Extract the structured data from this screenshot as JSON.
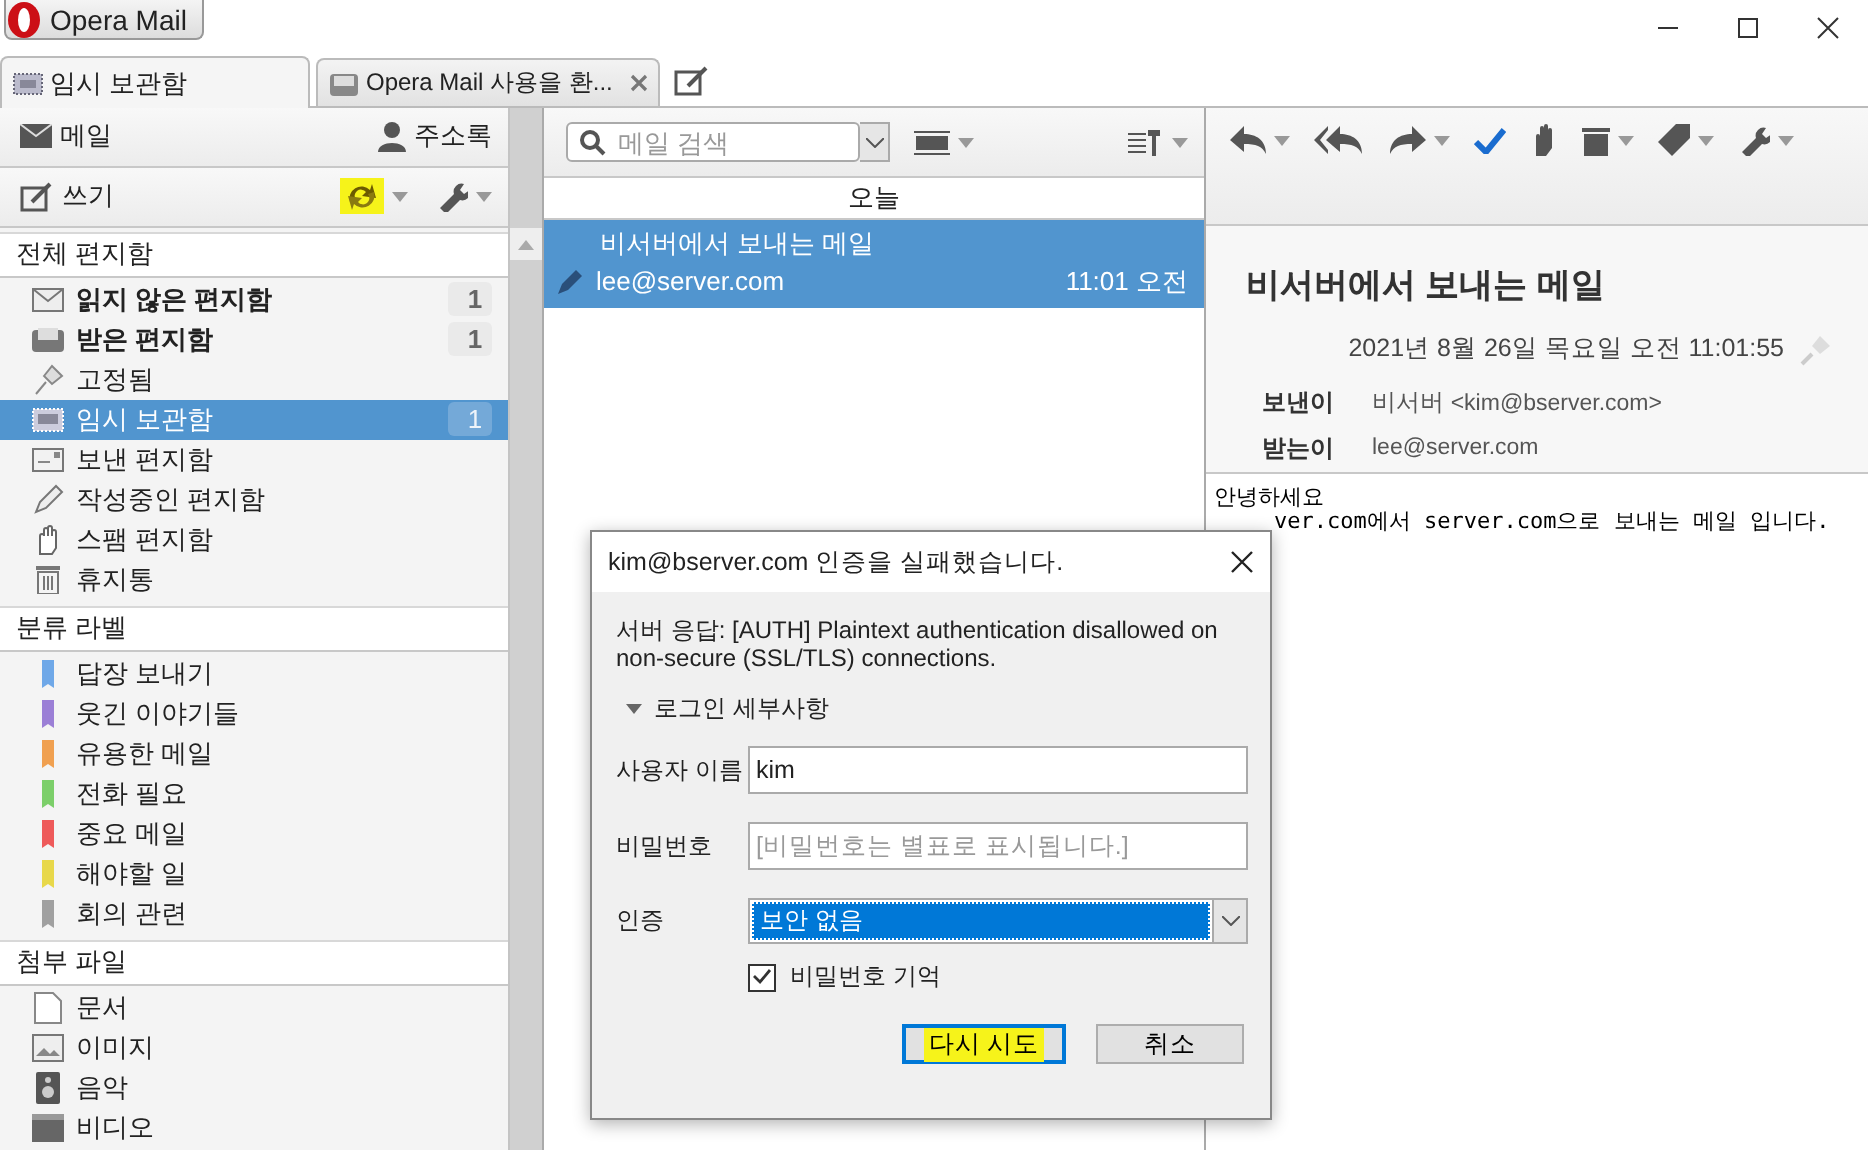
{
  "app_button": {
    "label": "Opera Mail"
  },
  "tabs": [
    {
      "label": "임시 보관함",
      "selected": true,
      "closable": false
    },
    {
      "label": "Opera Mail 사용을 환...",
      "selected": false,
      "closable": true
    }
  ],
  "sidebar": {
    "nav": [
      {
        "label": "메일"
      },
      {
        "label": "주소록"
      }
    ],
    "compose": {
      "label": "쓰기"
    },
    "sync_highlighted": true,
    "sections": [
      {
        "title": "전체 편지함",
        "items": [
          {
            "kind": "folder",
            "label": "읽지 않은 편지함",
            "unread": true,
            "selected": false,
            "count": "1"
          },
          {
            "kind": "folder",
            "label": "받은 편지함",
            "unread": true,
            "selected": false,
            "count": "1"
          },
          {
            "kind": "folder",
            "label": "고정됨",
            "unread": false,
            "selected": false
          },
          {
            "kind": "folder",
            "label": "임시 보관함",
            "unread": false,
            "selected": true,
            "count": "1"
          },
          {
            "kind": "folder",
            "label": "보낸 편지함",
            "unread": false,
            "selected": false
          },
          {
            "kind": "folder",
            "label": "작성중인 편지함",
            "unread": false,
            "selected": false
          },
          {
            "kind": "folder",
            "label": "스팸 편지함",
            "unread": false,
            "selected": false
          },
          {
            "kind": "folder",
            "label": "휴지통",
            "unread": false,
            "selected": false
          }
        ]
      },
      {
        "title": "분류 라벨",
        "items": [
          {
            "kind": "label",
            "label": "답장 보내기",
            "color": "#6fa8e8",
            "selected": false
          },
          {
            "kind": "label",
            "label": "웃긴 이야기들",
            "color": "#9b7fd6",
            "selected": false
          },
          {
            "kind": "label",
            "label": "유용한 메일",
            "color": "#f0a050",
            "selected": false
          },
          {
            "kind": "label",
            "label": "전화 필요",
            "color": "#7ccf6a",
            "selected": false
          },
          {
            "kind": "label",
            "label": "중요 메일",
            "color": "#ee5a5a",
            "selected": false
          },
          {
            "kind": "label",
            "label": "해야할 일",
            "color": "#e8d84a",
            "selected": false
          },
          {
            "kind": "label",
            "label": "회의 관련",
            "color": "#a0a0a0",
            "selected": false
          }
        ]
      },
      {
        "title": "첨부 파일",
        "items": [
          {
            "kind": "attachment",
            "label": "문서",
            "selected": false
          },
          {
            "kind": "attachment",
            "label": "이미지",
            "selected": false
          },
          {
            "kind": "attachment",
            "label": "음악",
            "selected": false
          },
          {
            "kind": "attachment",
            "label": "비디오",
            "selected": false
          }
        ]
      }
    ]
  },
  "message_list": {
    "search": {
      "placeholder": "메일 검색"
    },
    "group": "오늘",
    "messages": [
      {
        "subject": "비서버에서 보내는 메일",
        "from": "lee@server.com",
        "time": "11:01 오전",
        "selected": true
      }
    ]
  },
  "reader": {
    "subject": "비서버에서 보내는 메일",
    "date": "2021년 8월 26일 목요일 오전 11:01:55",
    "fields": [
      {
        "label": "보낸이",
        "name": "비서버",
        "address": "<kim@bserver.com>"
      },
      {
        "label": "받는이",
        "address": "lee@server.com"
      }
    ],
    "body": [
      "안녕하세요",
      "ver.com에서 server.com으로 보내는 메일 입니다."
    ]
  },
  "dialog": {
    "title": "kim@bserver.com 인증을 실패했습니다.",
    "message": "서버 응답: [AUTH] Plaintext authentication disallowed on non-secure (SSL/TLS) connections.",
    "details": {
      "label": "로그인 세부사항",
      "expanded": true
    },
    "username": {
      "label": "사용자 이름",
      "value": "kim"
    },
    "password": {
      "label": "비밀번호",
      "placeholder": "[비밀번호는 별표로 표시됩니다.]"
    },
    "auth": {
      "label": "인증",
      "value": "보안 없음"
    },
    "remember": {
      "label": "비밀번호 기억",
      "checked": true
    },
    "buttons": [
      {
        "label": "다시 시도",
        "default": true,
        "highlighted": true
      },
      {
        "label": "취소",
        "default": false,
        "highlighted": false
      }
    ]
  }
}
